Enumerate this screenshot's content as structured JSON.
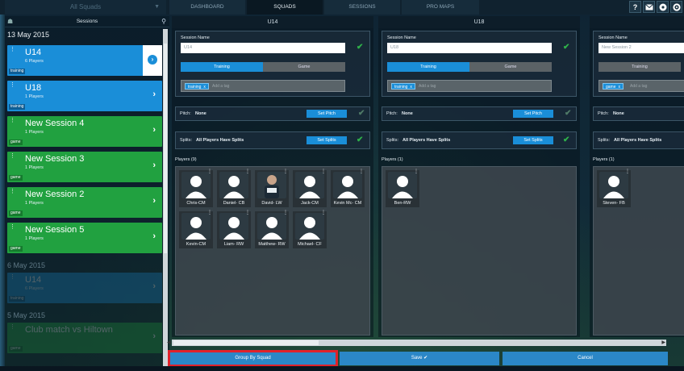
{
  "topbar": {
    "squad_filter": "All Squads",
    "tabs": [
      {
        "label": "DASHBOARD"
      },
      {
        "label": "SQUADS"
      },
      {
        "label": "SESSIONS"
      },
      {
        "label": "PRO MAPS"
      }
    ],
    "icons": [
      "help-icon",
      "mail-icon",
      "ball-icon",
      "settings-icon"
    ]
  },
  "sidebar": {
    "title": "Sessions",
    "groups": [
      {
        "date": "13 May 2015",
        "sessions": [
          {
            "name": "U14",
            "count": "6 Players",
            "tag": "training",
            "color": "#1a8ed8",
            "selected": true
          },
          {
            "name": "U18",
            "count": "1 Players",
            "tag": "training",
            "color": "#1a8ed8"
          },
          {
            "name": "New Session 4",
            "count": "1 Players",
            "tag": "game",
            "color": "#21a140"
          },
          {
            "name": "New Session 3",
            "count": "1 Players",
            "tag": "game",
            "color": "#21a140"
          },
          {
            "name": "New Session 2",
            "count": "1 Players",
            "tag": "game",
            "color": "#21a140"
          },
          {
            "name": "New Session 5",
            "count": "1 Players",
            "tag": "game",
            "color": "#21a140"
          }
        ]
      },
      {
        "date": "6 May 2015",
        "sessions": [
          {
            "name": "U14",
            "count": "6 Players",
            "tag": "training"
          }
        ]
      },
      {
        "date": "5 May 2015",
        "sessions": [
          {
            "name": "Club match vs Hiltown",
            "tag": "game"
          }
        ]
      }
    ]
  },
  "columns": [
    {
      "title": "U14",
      "session_name_label": "Session Name",
      "session_name_value": "U14",
      "type_options": [
        "Training",
        "Game"
      ],
      "type_selected": "Training",
      "tag": "training",
      "tag_remove": "x",
      "add_tag_placeholder": "Add a tag",
      "pitch_label": "Pitch:",
      "pitch_value": "None",
      "set_pitch": "Set Pitch",
      "splits_label": "Splits:",
      "splits_value": "All Players Have Splits",
      "set_splits": "Set Splits",
      "players_label": "Players (9)",
      "players": [
        "Chris-CM",
        "Daniel- CB",
        "David- LW",
        "Jack-CM",
        "Kevin Mc- CM",
        "Kevin-CM",
        "Liam- RW",
        "Matthew- RW",
        "Michael- CF"
      ]
    },
    {
      "title": "U18",
      "session_name_label": "Session Name",
      "session_name_value": "U18",
      "type_options": [
        "Training",
        "Game"
      ],
      "type_selected": "Training",
      "tag": "training",
      "tag_remove": "x",
      "add_tag_placeholder": "Add a tag",
      "pitch_label": "Pitch:",
      "pitch_value": "None",
      "set_pitch": "Set Pitch",
      "splits_label": "Splits:",
      "splits_value": "All Players Have Splits",
      "set_splits": "Set Splits",
      "players_label": "Players (1)",
      "players": [
        "Ben-RW"
      ]
    },
    {
      "session_name_label": "Session Name",
      "session_name_value": "New Session 2",
      "type_options": [
        "Training"
      ],
      "tag": "game",
      "tag_remove": "x",
      "add_tag_placeholder": "Add a tag",
      "pitch_label": "Pitch:",
      "pitch_value": "None",
      "splits_label": "Splits:",
      "splits_value": "All Players Have Splits",
      "players_label": "Players (1)",
      "players": [
        "Steven- FB"
      ]
    }
  ],
  "bottom": {
    "group_by": "Group By Squad",
    "save": "Save ✔",
    "cancel": "Cancel"
  },
  "colors": {
    "accent_blue": "#1a8ed8",
    "session_green": "#21a140",
    "check_green": "#2fb24a",
    "highlight_red": "#e0222b"
  }
}
